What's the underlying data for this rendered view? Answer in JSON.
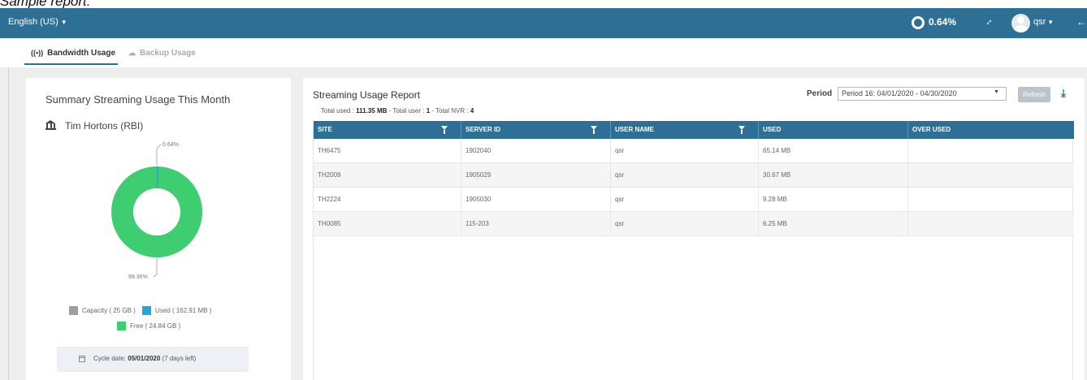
{
  "caption": "Sample report:",
  "topbar": {
    "language": "English (US)",
    "usage_percent": "0.64%",
    "username": "qsr"
  },
  "tabs": [
    {
      "label": "Bandwidth Usage",
      "active": true
    },
    {
      "label": "Backup Usage",
      "active": false
    }
  ],
  "summary": {
    "title": "Summary Streaming Usage This Month",
    "company": "Tim Hortons (RBI)",
    "donut": {
      "used_percent": 0.64,
      "free_percent": 99.36,
      "used_label": "0.64%",
      "free_label": "99.36%",
      "colors": {
        "used": "#26a5dc",
        "free": "#3fcd72",
        "capacity": "#9e9e9e"
      }
    },
    "legend": {
      "capacity": "Capacity ( 25 GB )",
      "used": "Used ( 162.91 MB )",
      "free": "Free ( 24.84 GB )"
    },
    "cycle": {
      "label": "Cycle date:",
      "date": "05/01/2020",
      "days_left": "(7 days left)"
    }
  },
  "report": {
    "title": "Streaming Usage Report",
    "summary": {
      "total_used_label": "Total used : ",
      "total_used_value": "111.35 MB",
      "total_user_label": " - Total user : ",
      "total_user_value": "1",
      "total_nvr_label": " - Total NVR : ",
      "total_nvr_value": "4"
    },
    "period_label": "Period",
    "period_value": "Period 16: 04/01/2020 - 04/30/2020",
    "refresh_label": "Refresh",
    "columns": [
      "SITE",
      "SERVER ID",
      "USER NAME",
      "USED",
      "OVER USED"
    ],
    "rows": [
      {
        "site": "TH6475",
        "server_id": "1902040",
        "user": "qsr",
        "used": "65.14 MB",
        "over": ""
      },
      {
        "site": "TH2009",
        "server_id": "1905029",
        "user": "qsr",
        "used": "30.67 MB",
        "over": ""
      },
      {
        "site": "TH2224",
        "server_id": "1905030",
        "user": "qsr",
        "used": "9.28 MB",
        "over": ""
      },
      {
        "site": "TH0085",
        "server_id": "115-203",
        "user": "qsr",
        "used": "6.25 MB",
        "over": ""
      }
    ]
  },
  "theme": {
    "primary": "#2e6f96"
  }
}
